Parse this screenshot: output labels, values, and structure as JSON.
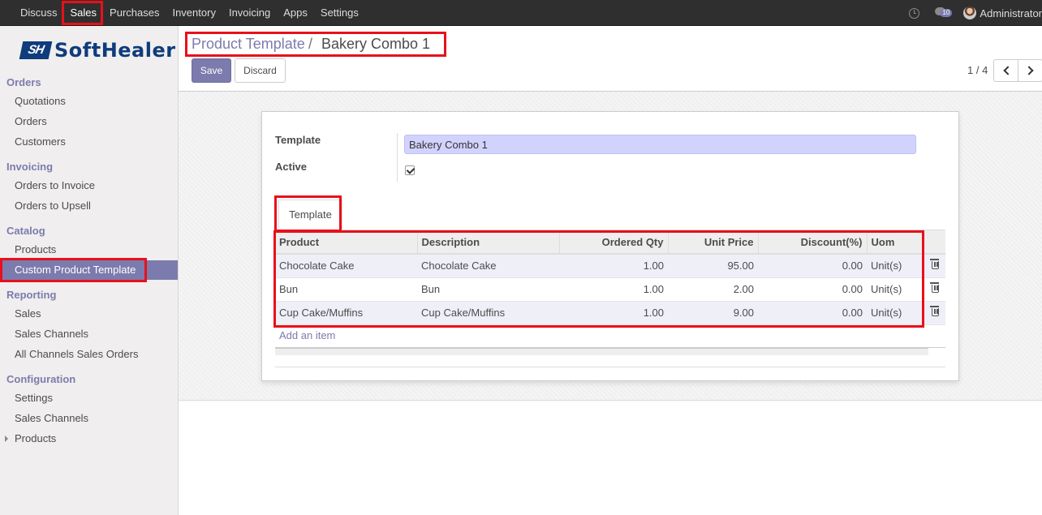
{
  "topnav": {
    "menus": [
      "Discuss",
      "Sales",
      "Purchases",
      "Inventory",
      "Invoicing",
      "Apps",
      "Settings"
    ],
    "active": "Sales",
    "chat_count": "10",
    "user_name": "Administrator"
  },
  "brand": {
    "mark": "SH",
    "name": "SoftHealer",
    "color": "#0e3c7c"
  },
  "sidebar": {
    "sections": [
      {
        "title": "Orders",
        "items": [
          "Quotations",
          "Orders",
          "Customers"
        ]
      },
      {
        "title": "Invoicing",
        "items": [
          "Orders to Invoice",
          "Orders to Upsell"
        ]
      },
      {
        "title": "Catalog",
        "items": [
          "Products",
          "Custom Product Template"
        ]
      },
      {
        "title": "Reporting",
        "items": [
          "Sales",
          "Sales Channels",
          "All Channels Sales Orders"
        ]
      },
      {
        "title": "Configuration",
        "items": [
          "Settings",
          "Sales Channels",
          "Products"
        ]
      }
    ],
    "active_item": "Custom Product Template"
  },
  "breadcrumb": {
    "parent": "Product Template",
    "separator": "/",
    "current": "Bakery Combo 1"
  },
  "buttons": {
    "save": "Save",
    "discard": "Discard"
  },
  "pager": {
    "value": "1 / 4"
  },
  "form": {
    "template_label": "Template",
    "template_value": "Bakery Combo 1",
    "active_label": "Active",
    "active_checked": true
  },
  "tabs": [
    "Template"
  ],
  "lines_table": {
    "headers": [
      "Product",
      "Description",
      "Ordered Qty",
      "Unit Price",
      "Discount(%)",
      "Uom"
    ],
    "rows": [
      [
        "Chocolate Cake",
        "Chocolate Cake",
        "1.00",
        "95.00",
        "0.00",
        "Unit(s)"
      ],
      [
        "Bun",
        "Bun",
        "1.00",
        "2.00",
        "0.00",
        "Unit(s)"
      ],
      [
        "Cup Cake/Muffins",
        "Cup Cake/Muffins",
        "1.00",
        "9.00",
        "0.00",
        "Unit(s)"
      ]
    ],
    "add_item": "Add an item"
  },
  "colors": {
    "accent": "#7c7bad",
    "highlight": "#e8101a",
    "topbar": "#2f2f2f"
  }
}
